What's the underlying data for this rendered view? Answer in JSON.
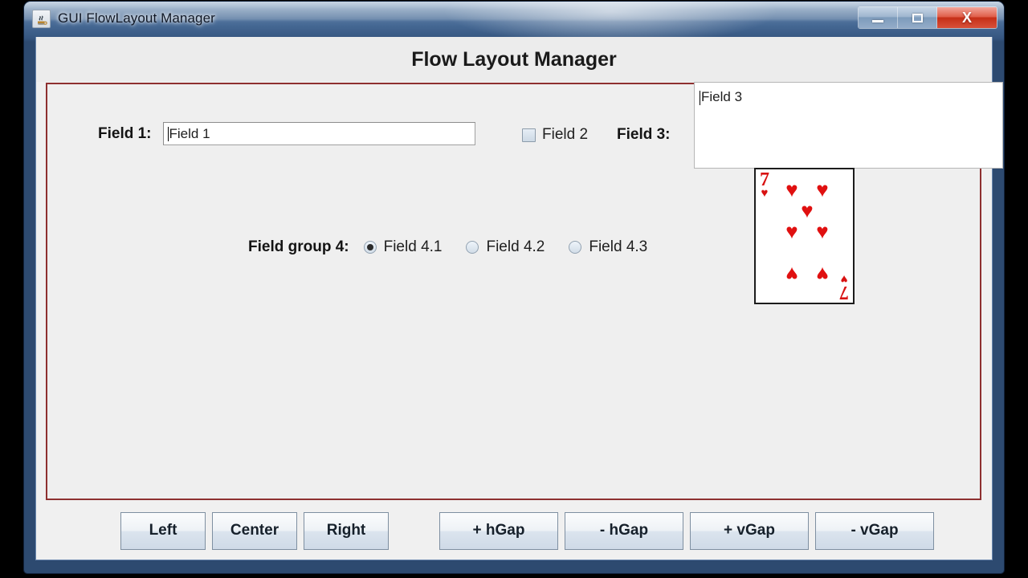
{
  "window": {
    "title": "GUI FlowLayout Manager",
    "icon": "java-coffee-cup-icon",
    "controls": {
      "minimize": "minimize-icon",
      "maximize": "maximize-icon",
      "close": "X"
    }
  },
  "heading": {
    "title": "Flow Layout Manager"
  },
  "form": {
    "field1": {
      "label": "Field 1:",
      "value": "Field 1"
    },
    "field2": {
      "label": "Field 2",
      "checked": false
    },
    "field3": {
      "label": "Field 3:",
      "value": "Field 3"
    },
    "group4": {
      "label": "Field group 4:",
      "options": [
        {
          "label": "Field 4.1",
          "selected": true
        },
        {
          "label": "Field 4.2",
          "selected": false
        },
        {
          "label": "Field 4.3",
          "selected": false
        }
      ]
    }
  },
  "card": {
    "rank": "7",
    "suit": "♥",
    "suit_name": "hearts",
    "color": "#e01010",
    "name": "seven-of-hearts"
  },
  "buttons": {
    "alignment": [
      "Left",
      "Center",
      "Right"
    ],
    "gaps": [
      "+ hGap",
      "- hGap",
      "+ vGap",
      "- vGap"
    ]
  },
  "colors": {
    "panel_border": "#8e3030",
    "window_frame": "#3f6390",
    "close_button": "#c52f18",
    "client_background": "#f0f0f0"
  }
}
